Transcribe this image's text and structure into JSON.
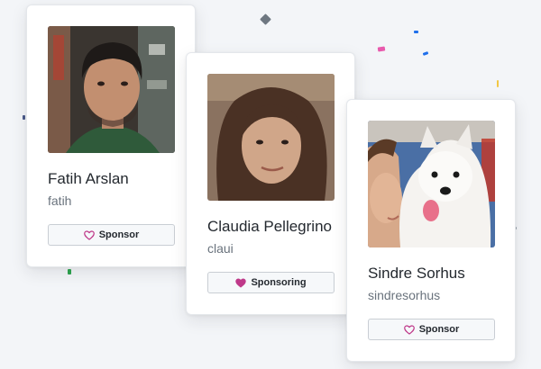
{
  "cards": [
    {
      "name": "Fatih Arslan",
      "handle": "fatih",
      "button_label": "Sponsor",
      "button_icon": "heart-outline-icon"
    },
    {
      "name": "Claudia Pellegrino",
      "handle": "claui",
      "button_label": "Sponsoring",
      "button_icon": "heart-filled-icon"
    },
    {
      "name": "Sindre Sorhus",
      "handle": "sindresorhus",
      "button_label": "Sponsor",
      "button_icon": "heart-outline-icon"
    }
  ],
  "colors": {
    "sponsor_pink": "#bf3989",
    "background": "#f3f5f8"
  }
}
